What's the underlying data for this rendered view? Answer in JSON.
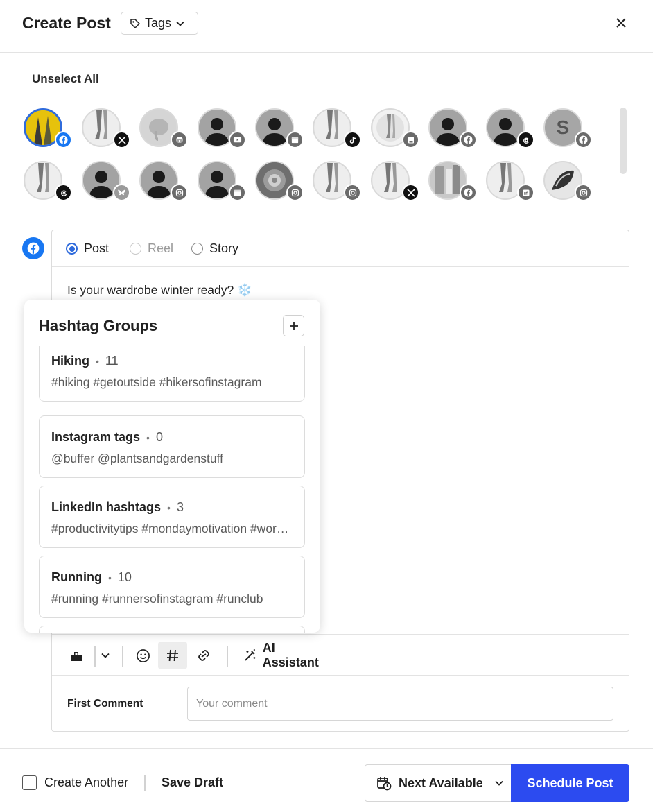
{
  "header": {
    "title": "Create Post",
    "tags_label": "Tags"
  },
  "unselect_all": "Unselect All",
  "accounts": [
    {
      "avatar": "yellow-photo",
      "network": "facebook",
      "selected": true
    },
    {
      "avatar": "photo",
      "network": "x"
    },
    {
      "avatar": "mastodon-elephant",
      "network": "mastodon"
    },
    {
      "avatar": "default",
      "network": "youtube"
    },
    {
      "avatar": "default",
      "network": "google-business"
    },
    {
      "avatar": "photo",
      "network": "tiktok"
    },
    {
      "avatar": "photo",
      "network": "start-page"
    },
    {
      "avatar": "default",
      "network": "facebook"
    },
    {
      "avatar": "default",
      "network": "threads"
    },
    {
      "avatar": "letter-s",
      "network": "facebook"
    },
    {
      "avatar": "photo",
      "network": "threads"
    },
    {
      "avatar": "default",
      "network": "bluesky"
    },
    {
      "avatar": "default",
      "network": "instagram"
    },
    {
      "avatar": "default",
      "network": "google-business"
    },
    {
      "avatar": "photo",
      "network": "instagram"
    },
    {
      "avatar": "photo",
      "network": "instagram"
    },
    {
      "avatar": "photo",
      "network": "x"
    },
    {
      "avatar": "photo",
      "network": "facebook"
    },
    {
      "avatar": "photo",
      "network": "linkedin"
    },
    {
      "avatar": "photo",
      "network": "instagram"
    }
  ],
  "avatar_letter": "S",
  "composer": {
    "types": [
      {
        "label": "Post",
        "state": "checked"
      },
      {
        "label": "Reel",
        "state": "disabled"
      },
      {
        "label": "Story",
        "state": "unchecked"
      }
    ],
    "text": "Is your wardrobe winter ready? ❄️",
    "ai_assistant": "AI Assistant",
    "first_comment_label": "First Comment",
    "comment_placeholder": "Your comment"
  },
  "hashtag_groups": {
    "title": "Hashtag Groups",
    "items": [
      {
        "name": "Hiking",
        "count": "11",
        "tags": "#hiking #getoutside #hikersofinstagram"
      },
      {
        "name": "Instagram tags",
        "count": "0",
        "tags": "@buffer @plantsandgardenstuff"
      },
      {
        "name": "LinkedIn hashtags",
        "count": "3",
        "tags": "#productivitytips #mondaymotivation #worklife"
      },
      {
        "name": "Running",
        "count": "10",
        "tags": "#running #runnersofinstagram #runclub"
      }
    ]
  },
  "footer": {
    "create_another": "Create Another",
    "save_draft": "Save Draft",
    "next_available": "Next Available",
    "schedule_post": "Schedule Post"
  },
  "colors": {
    "accent": "#2c4bf0",
    "facebook": "#1877f2",
    "radio": "#2f6bdc"
  }
}
